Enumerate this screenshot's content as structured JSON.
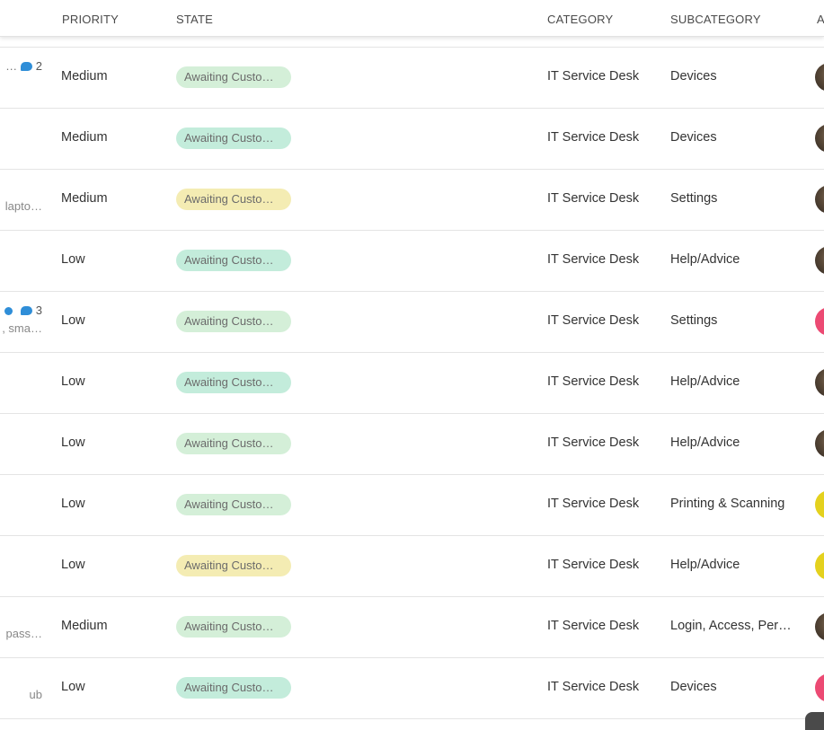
{
  "header": {
    "priority": "PRIORITY",
    "state": "STATE",
    "category": "CATEGORY",
    "subcategory": "SUBCATEGORY",
    "assignee_partial": "A"
  },
  "colors": {
    "pill_green": "#d4efd8",
    "pill_teal": "#c3ecdb",
    "pill_yellow": "#f4ecb3",
    "avatar_pink": "#ec4a73",
    "avatar_yellow": "#e4d11e",
    "comment_icon": "#2f8ed8"
  },
  "rows": [
    {
      "line1": "…",
      "comments": "2",
      "line2": "",
      "priority": "Medium",
      "state": "Awaiting Custo…",
      "state_color": "green",
      "category": "IT Service Desk",
      "subcategory": "Devices",
      "avatar": "photo"
    },
    {
      "line1": "",
      "comments": "",
      "line2": "",
      "priority": "Medium",
      "state": "Awaiting Custo…",
      "state_color": "teal",
      "category": "IT Service Desk",
      "subcategory": "Devices",
      "avatar": "photo"
    },
    {
      "line1": "",
      "comments": "",
      "line2": "lapto…",
      "priority": "Medium",
      "state": "Awaiting Custo…",
      "state_color": "yellow",
      "category": "IT Service Desk",
      "subcategory": "Settings",
      "avatar": "photo"
    },
    {
      "line1": "",
      "comments": "",
      "line2": "",
      "priority": "Low",
      "state": "Awaiting Custo…",
      "state_color": "teal",
      "category": "IT Service Desk",
      "subcategory": "Help/Advice",
      "avatar": "photo"
    },
    {
      "line1": "",
      "comments": "3",
      "line2": ", sma…",
      "priority": "Low",
      "state": "Awaiting Custo…",
      "state_color": "green",
      "category": "IT Service Desk",
      "subcategory": "Settings",
      "avatar": "pink"
    },
    {
      "line1": "",
      "comments": "",
      "line2": "",
      "priority": "Low",
      "state": "Awaiting Custo…",
      "state_color": "teal",
      "category": "IT Service Desk",
      "subcategory": "Help/Advice",
      "avatar": "photo"
    },
    {
      "line1": "",
      "comments": "",
      "line2": "",
      "priority": "Low",
      "state": "Awaiting Custo…",
      "state_color": "green",
      "category": "IT Service Desk",
      "subcategory": "Help/Advice",
      "avatar": "photo"
    },
    {
      "line1": "",
      "comments": "",
      "line2": "",
      "priority": "Low",
      "state": "Awaiting Custo…",
      "state_color": "green",
      "category": "IT Service Desk",
      "subcategory": "Printing & Scanning",
      "avatar": "yellow"
    },
    {
      "line1": "",
      "comments": "",
      "line2": "",
      "priority": "Low",
      "state": "Awaiting Custo…",
      "state_color": "yellow",
      "category": "IT Service Desk",
      "subcategory": "Help/Advice",
      "avatar": "yellow"
    },
    {
      "line1": "",
      "comments": "",
      "line2": "pass…",
      "priority": "Medium",
      "state": "Awaiting Custo…",
      "state_color": "green",
      "category": "IT Service Desk",
      "subcategory": "Login, Access, Per…",
      "avatar": "photo"
    },
    {
      "line1": "",
      "comments": "",
      "line2": "ub",
      "priority": "Low",
      "state": "Awaiting Custo…",
      "state_color": "teal",
      "category": "IT Service Desk",
      "subcategory": "Devices",
      "avatar": "pink"
    }
  ]
}
